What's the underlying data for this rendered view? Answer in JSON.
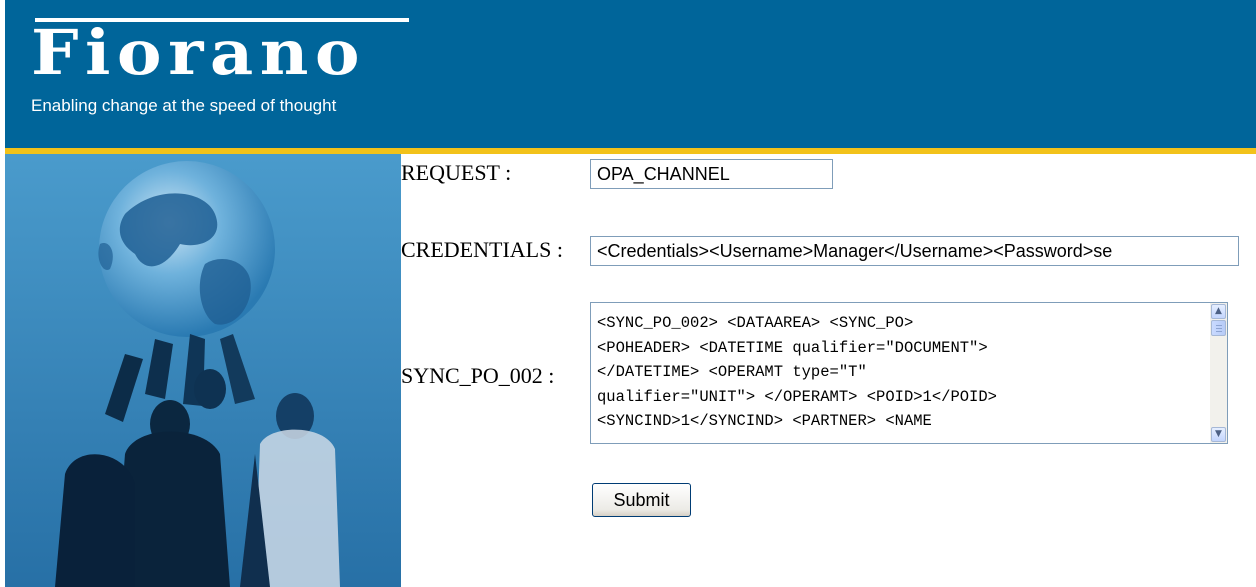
{
  "header": {
    "logo": "Fiorano",
    "tagline": "Enabling change at the speed of thought"
  },
  "form": {
    "request_label": "REQUEST :",
    "request_value": "OPA_CHANNEL",
    "credentials_label": "CREDENTIALS :",
    "credentials_value": "<Credentials><Username>Manager</Username><Password>se",
    "sync_label": "SYNC_PO_002 :",
    "sync_value": "<SYNC_PO_002> <DATAAREA> <SYNC_PO>\n<POHEADER> <DATETIME qualifier=\"DOCUMENT\">\n</DATETIME> <OPERAMT type=\"T\"\nqualifier=\"UNIT\"> </OPERAMT> <POID>1</POID>\n<SYNCIND>1</SYNCIND> <PARTNER> <NAME",
    "submit_label": "Submit"
  },
  "colors": {
    "header_bg": "#00659a",
    "accent_stripe": "#f2c21a"
  },
  "icons": {
    "scroll_up": "scroll-up-arrow-icon",
    "scroll_down": "scroll-down-arrow-icon"
  }
}
